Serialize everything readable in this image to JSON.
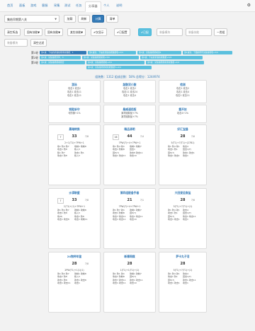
{
  "nav": {
    "items": [
      "首页",
      "面板",
      "游戏",
      "客服",
      "采集",
      "测试",
      "任务",
      "分享器",
      "个人",
      "说明"
    ],
    "active_index": 7
  },
  "controls": {
    "select_value": "集结早期第八关",
    "btn_load": "加载",
    "btn_refresh": "刷新",
    "btn_calc": "计算",
    "btn_clear": "清单"
  },
  "filters": {
    "items": [
      "清空所选",
      "固有技能▼",
      "固有技能▼",
      "某些技能▼",
      "✔仅显示",
      "✔已配置",
      "✔已配",
      "装备模块",
      "装备技能",
      "一类组"
    ],
    "row2": [
      "装备模块",
      "清空过滤"
    ]
  },
  "phases": {
    "phase1_label": "第1轮",
    "phase1_tags": [
      "第1波：下在的某些技能重复数据：1",
      "第1波次：下在的某些技能数据项+2/4",
      "第1波：某些技能组成第1",
      "第1波次：下面的所有某些技能项+3/4"
    ],
    "phase2_label": "第2轮",
    "phase2_tags": [
      "第1波：某些技能条件：3",
      "第1波：某些技能组成项+3/4",
      "第1波：下在的某些技能数据+3/4"
    ],
    "phase3_label": "第3轮",
    "phase3_tags": [
      "第1波：某些技能组成组合",
      "第2波：某些技能组成+2/4",
      "第3波：某些技能组成重复数据+4/4"
    ],
    "phase3_last": "第1波：某些技能组成技能数据3+4/4"
  },
  "stats": {
    "text": "组装数：1312 组成总数：58% 总得分：1244974"
  },
  "cards_row1": [
    {
      "title": "游泳",
      "lines": [
        "攻击1 攻击2",
        "攻击1 攻击11",
        "攻击1 攻击11"
      ]
    },
    {
      "title": "敲鼓双小鼓",
      "lines": [
        "攻击1 攻击2",
        "攻击11 攻击24",
        "攻击1 攻击4"
      ]
    },
    {
      "title": "检测",
      "lines": [
        "攻击1 攻击2",
        "攻击1 攻击4",
        "攻击1 攻击11"
      ]
    }
  ],
  "cards_row2": [
    {
      "title": "钥匙斩守",
      "lines": [
        "可防御+1%"
      ]
    },
    {
      "title": "桑威通用版",
      "lines": [
        "某项组制品+7%",
        "某项组制品+7%"
      ]
    },
    {
      "title": "重开技",
      "lines": [
        "攻击4+1%"
      ]
    }
  ],
  "cards_row3": [
    {
      "title": "黑暗转换",
      "box": "7",
      "num": "33",
      "side": "7/8",
      "code": "2+1(T1)+7PW+1",
      "subs": [
        "攻1 防4 防7",
        "攻制1 攻制8",
        "攻击1 防8",
        "移入5",
        "移1 防7",
        "攻击1 防1",
        "攻击1 防8",
        "移入5"
      ]
    },
    {
      "title": "精品清明",
      "box": "16",
      "num": "44",
      "side": "7/4",
      "code": "7PW(7)+4+7PW+1",
      "subs": [
        "攻1 防4 攻4",
        "攻制1 攻制7",
        "攻击1 防制8",
        "回击1",
        "回8(7)",
        "攻击8 攻击11",
        "攻击1 攻击11",
        "攻击10"
      ]
    },
    {
      "title": "好汇宝器",
      "box": "",
      "num": "28",
      "side": "7/6",
      "code": "5(T1)+7(T1)+(27B1)",
      "subs": [
        "攻1 防4 攻1",
        "攻击4",
        "攻击1 防1",
        "回击1(F)",
        "回8(7)",
        "攻击1 攻击1",
        "攻击1 攻击1",
        "攻击1"
      ]
    }
  ],
  "cards_row4": [
    {
      "title": "沙漠联盟",
      "box": "7",
      "num": "33",
      "side": "7/8",
      "code": "2(T1)+(1)+7PW+1",
      "subs": [
        "攻1 防4 防7",
        "攻制1 攻制8",
        "攻击1 防8",
        "移入5",
        "攻(8)",
        "攻击1 防8",
        "攻击1 攻击8",
        "攻击1 攻制11"
      ]
    },
    {
      "title": "第四组配备手套",
      "box": "",
      "num": "21",
      "side": "7/1",
      "code": "7PW(7)+4+7PW+1",
      "subs": [
        "攻1 防7 攻4",
        "攻制1 攻制7",
        "攻击1 防制8",
        "回8(7)",
        "攻击7 攻击11",
        "攻击1 攻击11",
        "攻击1 攻击11",
        "攻击10"
      ]
    },
    {
      "title": "大田爱运食盐",
      "box": "",
      "num": "28",
      "side": "7/6",
      "code": "5(T1)+7(T1)+(1)",
      "subs": [
        "攻1 防4 攻1",
        "攻击4",
        "攻击1 防1",
        "回击1(F)",
        "回8(7)",
        "攻击1 攻击11",
        "攻击1 攻击1",
        "攻击1"
      ]
    }
  ],
  "cards_row5": [
    {
      "title": "24物种年鉴",
      "box": "",
      "num": "28",
      "side": "7/8",
      "code": "2PW(T1)+1(1)(1)",
      "subs": [
        "攻1 防4 防7",
        "攻制1 攻制8",
        "攻击1 防8",
        "移入5",
        "攻击1 防8",
        "攻击1 攻击8",
        "攻击1 攻击11",
        "攻击1"
      ]
    },
    {
      "title": "新春网媒",
      "box": "",
      "num": "28",
      "side": "",
      "code": "1(T1)+1(T1)+(1)",
      "subs": [
        "攻1 防1 攻4",
        "攻制1 攻制7",
        "攻击1 防制8",
        "回8(7)",
        "攻击7 攻击11",
        "攻击1 攻击11",
        "攻击1 攻击11",
        "攻击10"
      ]
    },
    {
      "title": "萨卡丸子活",
      "box": "",
      "num": "28",
      "side": "",
      "code": "5(T1)+7(T1)+(1)",
      "subs": [
        "攻1 防4 攻1",
        "攻击4",
        "攻击1 防1",
        "回击1(F)",
        "回8(7)",
        "攻击1 攻击11",
        "攻击1 攻击1",
        "攻击1"
      ]
    }
  ]
}
